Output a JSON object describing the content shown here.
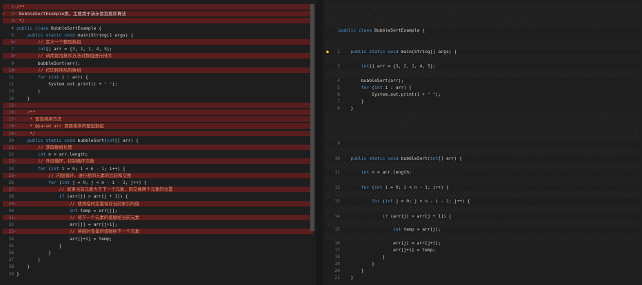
{
  "left": {
    "lines": [
      {
        "n": "1",
        "mark": "-",
        "del": true,
        "text": "/**"
      },
      {
        "n": "2",
        "mark": "-",
        "del": true,
        "text": " BubbleSortExample类，主要用于演示冒泡排序算法",
        "bulb": true
      },
      {
        "n": "3",
        "mark": "-",
        "del": true,
        "text": " */"
      },
      {
        "n": "4",
        "mark": "",
        "del": false,
        "text": "public class BubbleSortExample {"
      },
      {
        "n": "5",
        "mark": "",
        "del": false,
        "text": "    public static void main(String[] args) {"
      },
      {
        "n": "6",
        "mark": "-",
        "del": true,
        "text": "        // 定义一个整型数组"
      },
      {
        "n": "7",
        "mark": "",
        "del": false,
        "text": "        int[] arr = {3, 2, 1, 4, 5};"
      },
      {
        "n": "8",
        "mark": "-",
        "del": true,
        "text": "        // 调用冒泡排序方法对数组进行排序"
      },
      {
        "n": "9",
        "mark": "",
        "del": false,
        "text": "        bubbleSort(arr);"
      },
      {
        "n": "10",
        "mark": "-",
        "del": true,
        "text": "        // 打印排序后的数组"
      },
      {
        "n": "11",
        "mark": "",
        "del": false,
        "text": "        for (int i : arr) {"
      },
      {
        "n": "12",
        "mark": "",
        "del": false,
        "text": "            System.out.print(i + \" \");"
      },
      {
        "n": "13",
        "mark": "",
        "del": false,
        "text": "        }"
      },
      {
        "n": "14",
        "mark": "",
        "del": false,
        "text": "    }"
      },
      {
        "n": "15",
        "mark": "-",
        "del": true,
        "text": ""
      },
      {
        "n": "16",
        "mark": "-",
        "del": true,
        "text": "    /**"
      },
      {
        "n": "17",
        "mark": "-",
        "del": true,
        "text": "     * 冒泡排序方法"
      },
      {
        "n": "18",
        "mark": "-",
        "del": true,
        "text": "     * @param arr 需要排序的整型数组"
      },
      {
        "n": "19",
        "mark": "-",
        "del": true,
        "text": "     */"
      },
      {
        "n": "20",
        "mark": "",
        "del": false,
        "text": "    public static void bubbleSort(int[] arr) {"
      },
      {
        "n": "21",
        "mark": "-",
        "del": true,
        "text": "        // 获取数组长度"
      },
      {
        "n": "22",
        "mark": "",
        "del": false,
        "text": "        int n = arr.length;"
      },
      {
        "n": "23",
        "mark": "-",
        "del": true,
        "text": "        // 外层循环，控制循环次数"
      },
      {
        "n": "24",
        "mark": "",
        "del": false,
        "text": "        for (int i = 0; i < n - 1; i++) {"
      },
      {
        "n": "25",
        "mark": "-",
        "del": true,
        "text": "            // 内层循环，进行相邻元素的比较和交换"
      },
      {
        "n": "26",
        "mark": "",
        "del": false,
        "text": "            for (int j = 0; j < n - i - 1; j++) {"
      },
      {
        "n": "27",
        "mark": "-",
        "del": true,
        "text": "                // 如果当前元素大于下一个元素，则交换两个元素的位置"
      },
      {
        "n": "28",
        "mark": "",
        "del": false,
        "text": "                if (arr[j] > arr[j + 1]) {"
      },
      {
        "n": "29",
        "mark": "-",
        "del": true,
        "text": "                    // 使用临时变量保存当前索引的值"
      },
      {
        "n": "30",
        "mark": "",
        "del": false,
        "text": "                    int temp = arr[j];"
      },
      {
        "n": "31",
        "mark": "-",
        "del": true,
        "text": "                    // 将下一个元素的值赋给当前元素"
      },
      {
        "n": "32",
        "mark": "",
        "del": false,
        "text": "                    arr[j] = arr[j+1];"
      },
      {
        "n": "33",
        "mark": "-",
        "del": true,
        "text": "                    // 将临时变量的值赋给下一个元素"
      },
      {
        "n": "34",
        "mark": "",
        "del": false,
        "text": "                    arr[j+1] = temp;"
      },
      {
        "n": "35",
        "mark": "",
        "del": false,
        "text": "                }"
      },
      {
        "n": "36",
        "mark": "",
        "del": false,
        "text": "            }"
      },
      {
        "n": "37",
        "mark": "",
        "del": false,
        "text": "        }"
      },
      {
        "n": "38",
        "mark": "",
        "del": false,
        "text": "    }"
      },
      {
        "n": "39",
        "mark": "",
        "del": false,
        "text": "}"
      }
    ]
  },
  "right": {
    "lines": [
      {
        "n": "1",
        "text": "public class BubbleSortExample {"
      },
      {
        "n": "2",
        "text": "    public static void main(String[] args) {",
        "bulb": true
      },
      {
        "n": "3",
        "text": "        int[] arr = {3, 2, 1, 4, 5};"
      },
      {
        "n": "4",
        "text": "        bubbleSort(arr);"
      },
      {
        "n": "5",
        "text": "        for (int i : arr) {"
      },
      {
        "n": "6",
        "text": "            System.out.print(i + \" \");"
      },
      {
        "n": "7",
        "text": "        }"
      },
      {
        "n": "8",
        "text": "    }"
      },
      {
        "n": "9",
        "text": ""
      },
      {
        "n": "10",
        "text": "    public static void bubbleSort(int[] arr) {"
      },
      {
        "n": "11",
        "text": "        int n = arr.length;"
      },
      {
        "n": "12",
        "text": "        for (int i = 0; i < n - 1; i++) {"
      },
      {
        "n": "13",
        "text": "            for (int j = 0; j < n - i - 1; j++) {"
      },
      {
        "n": "14",
        "text": "                if (arr[j] > arr[j + 1]) {"
      },
      {
        "n": "15",
        "text": "                    int temp = arr[j];"
      },
      {
        "n": "16",
        "text": "                    arr[j] = arr[j+1];"
      },
      {
        "n": "17",
        "text": "                    arr[j+1] = temp;"
      },
      {
        "n": "18",
        "text": "                }"
      },
      {
        "n": "19",
        "text": "            }"
      },
      {
        "n": "20",
        "text": "        }"
      },
      {
        "n": "21",
        "text": "    }"
      },
      {
        "n": "22",
        "text": "}"
      }
    ]
  },
  "colors": {
    "deleted_line": "#5a1d1d",
    "background": "#1e1e1e",
    "keyword": "#569cd6",
    "comment": "#e5906a"
  }
}
